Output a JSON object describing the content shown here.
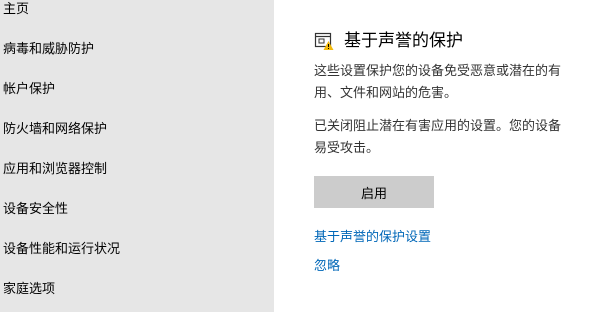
{
  "sidebar": {
    "items": [
      {
        "label": "主页"
      },
      {
        "label": "病毒和威胁防护"
      },
      {
        "label": "帐户保护"
      },
      {
        "label": "防火墙和网络保护"
      },
      {
        "label": "应用和浏览器控制"
      },
      {
        "label": "设备安全性"
      },
      {
        "label": "设备性能和运行状况"
      },
      {
        "label": "家庭选项"
      }
    ]
  },
  "main": {
    "icon": "app-warning-icon",
    "title": "基于声誉的保护",
    "description_lines": [
      "这些设置保护您的设备免受恶意或潜在的有",
      "用、文件和网站的危害。"
    ],
    "status_lines": [
      "已关闭阻止潜在有害应用的设置。您的设备",
      "易受攻击。"
    ],
    "enable_button": "启用",
    "settings_link": "基于声誉的保护设置",
    "ignore_link": "忽略",
    "colors": {
      "link": "#0067b8",
      "sidebar_bg": "#e6e6e6",
      "button_bg": "#cccccc",
      "warning": "#f2b90c"
    }
  }
}
